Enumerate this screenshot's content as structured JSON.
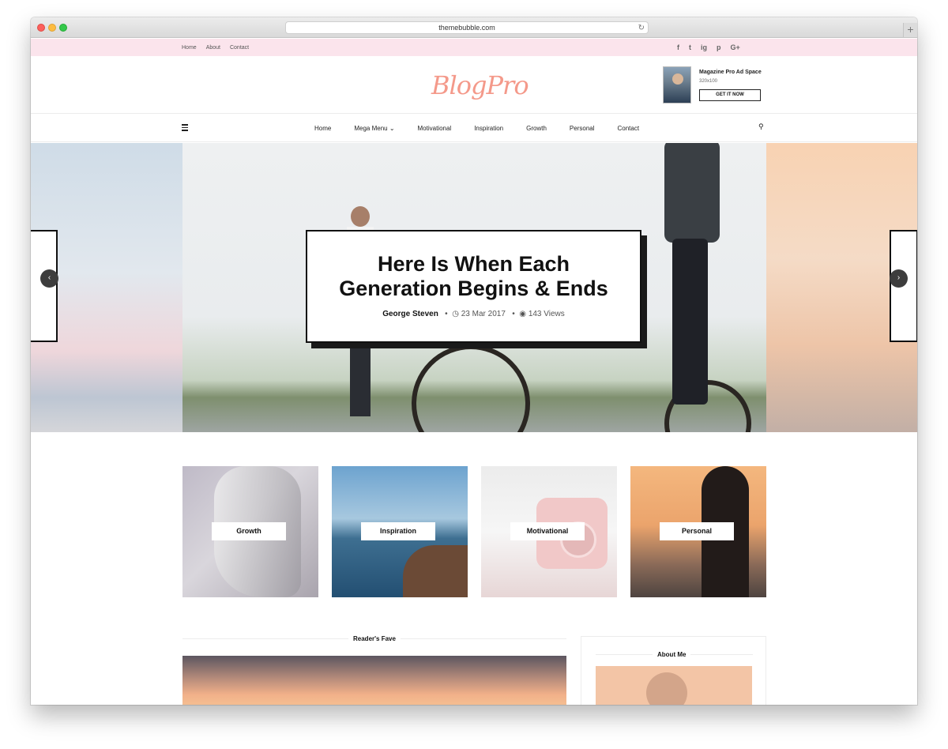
{
  "browser": {
    "url": "themebubble.com",
    "new_tab": "+"
  },
  "topbar": {
    "links": [
      "Home",
      "About",
      "Contact"
    ],
    "socials": [
      "f",
      "t",
      "ig",
      "p",
      "G+"
    ]
  },
  "header": {
    "logo": "BlogPro",
    "ad": {
      "title": "Magazine Pro Ad Space",
      "size": "320x100",
      "button": "GET IT NOW"
    }
  },
  "nav": {
    "items": [
      "Home",
      "Mega Menu ⌄",
      "Motivational",
      "Inspiration",
      "Growth",
      "Personal",
      "Contact"
    ]
  },
  "hero": {
    "title_line1": "Here Is When Each",
    "title_line2": "Generation Begins & Ends",
    "author": "George Steven",
    "date": "23 Mar 2017",
    "views": "143 Views",
    "prev": "‹",
    "next": "›"
  },
  "categories": [
    {
      "label": "Growth"
    },
    {
      "label": "Inspiration"
    },
    {
      "label": "Motivational"
    },
    {
      "label": "Personal"
    }
  ],
  "sections": {
    "readers_fave": "Reader's Fave",
    "about_me": "About Me"
  },
  "colors": {
    "topbar_bg": "#fbe4ec",
    "logo": "#f4998a"
  }
}
